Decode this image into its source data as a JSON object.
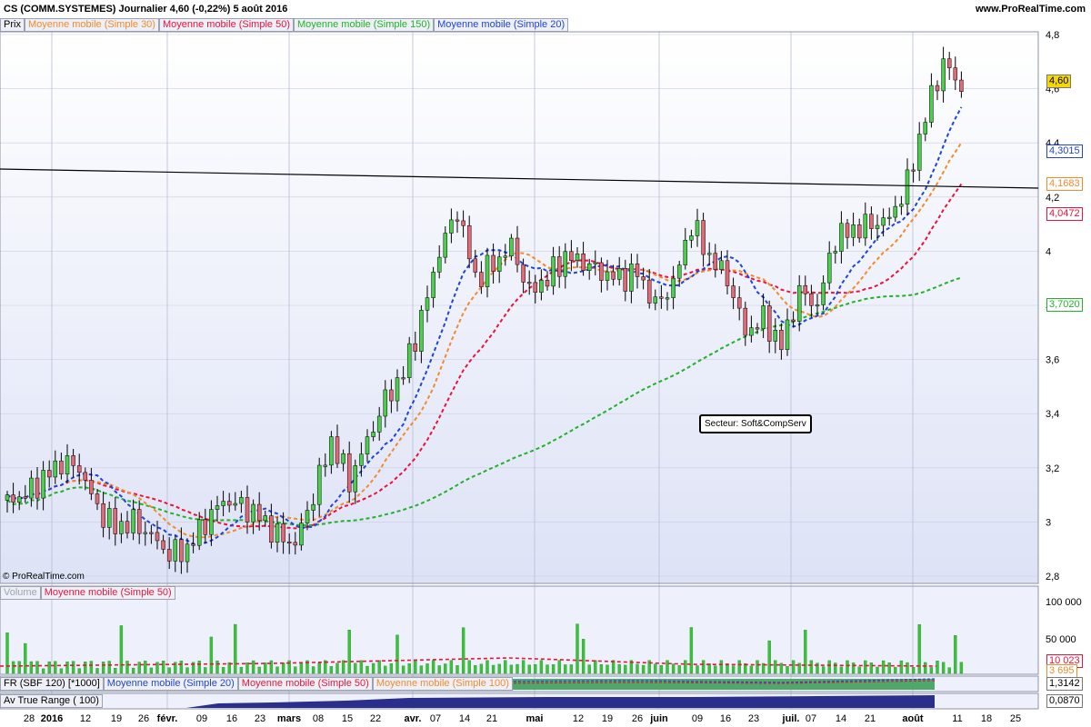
{
  "header": {
    "title": "CS (COMM.SYSTEMES)   Journalier   4,60 (-0,22%)   5 août 2016",
    "site": "www.ProRealTime.com"
  },
  "price_panel": {
    "legend": [
      "Prix",
      "Moyenne mobile (Simple 30)",
      "Moyenne mobile (Simple 50)",
      "Moyenne mobile (Simple 150)",
      "Moyenne mobile (Simple 20)"
    ],
    "y_ticks": [
      "4,8",
      "4,6",
      "4,4",
      "4,2",
      "4",
      "3,8",
      "3,6",
      "3,4",
      "3,2",
      "3",
      "2,8"
    ],
    "badges": {
      "last": "4,60",
      "ma20": "4,3015",
      "ma30": "4,1683",
      "ma50": "4,0472",
      "ma150": "3,7020"
    },
    "sector_label": "Secteur: Soft&CompServ",
    "copyright": "© ProRealTime.com",
    "colors": {
      "ma20": "#1f44d6",
      "ma30": "#f28a2e",
      "ma50": "#e8143c",
      "ma150": "#22b22a",
      "up": "#4ccf4c",
      "down": "#e06a78",
      "trend": "#000000"
    }
  },
  "volume_panel": {
    "legend": [
      "Volume",
      "Moyenne mobile (Simple 50)"
    ],
    "y_ticks": [
      "100 000",
      "50 000"
    ],
    "badges": {
      "avg": "10 023",
      "last": "3 695"
    }
  },
  "fr_panel": {
    "legend": [
      "FR (SBF 120) [*1000]",
      "Moyenne mobile (Simple 20)",
      "Moyenne mobile (Simple 50)",
      "Moyenne mobile (Simple 100)"
    ],
    "badge": "1,3142"
  },
  "atr_panel": {
    "legend": [
      "Av True Range ( 100)"
    ],
    "badge": "0,0870"
  },
  "x_axis": {
    "labels": [
      "28",
      "2016",
      "12",
      "19",
      "26",
      "févr.",
      "09",
      "16",
      "23",
      "mars",
      "08",
      "15",
      "22",
      "avr.",
      "07",
      "14",
      "21",
      "mai",
      "12",
      "19",
      "26",
      "juin",
      "09",
      "16",
      "23",
      "juil.",
      "07",
      "14",
      "21",
      "août",
      "11",
      "18",
      "25"
    ]
  },
  "chart_data": {
    "type": "candlestick",
    "title": "CS (COMM.SYSTEMES) Journalier",
    "ylim": [
      2.8,
      4.85
    ],
    "series": [
      {
        "name": "Moyenne mobile (Simple 20)",
        "last": 4.3015
      },
      {
        "name": "Moyenne mobile (Simple 30)",
        "last": 4.1683
      },
      {
        "name": "Moyenne mobile (Simple 50)",
        "last": 4.0472
      },
      {
        "name": "Moyenne mobile (Simple 150)",
        "last": 3.702
      }
    ],
    "close_path": [
      [
        0,
        3.08
      ],
      [
        6,
        3.1
      ],
      [
        12,
        3.16
      ],
      [
        18,
        3.22
      ],
      [
        24,
        3.2
      ],
      [
        30,
        3.05
      ],
      [
        36,
        2.98
      ],
      [
        42,
        3.0
      ],
      [
        48,
        2.95
      ],
      [
        54,
        2.88
      ],
      [
        60,
        2.9
      ],
      [
        66,
        3.0
      ],
      [
        72,
        3.08
      ],
      [
        78,
        3.06
      ],
      [
        84,
        3.02
      ],
      [
        90,
        2.95
      ],
      [
        96,
        2.92
      ],
      [
        102,
        3.1
      ],
      [
        108,
        3.3
      ],
      [
        114,
        3.15
      ],
      [
        120,
        3.3
      ],
      [
        126,
        3.45
      ],
      [
        132,
        3.55
      ],
      [
        138,
        3.75
      ],
      [
        144,
        4.0
      ],
      [
        150,
        4.15
      ],
      [
        156,
        3.9
      ],
      [
        162,
        3.95
      ],
      [
        168,
        4.02
      ],
      [
        174,
        3.85
      ],
      [
        180,
        3.9
      ],
      [
        186,
        3.98
      ],
      [
        192,
        3.96
      ],
      [
        198,
        3.92
      ],
      [
        204,
        3.9
      ],
      [
        210,
        3.92
      ],
      [
        216,
        3.8
      ],
      [
        222,
        3.88
      ],
      [
        228,
        4.1
      ],
      [
        234,
        3.98
      ],
      [
        240,
        3.9
      ],
      [
        246,
        3.7
      ],
      [
        252,
        3.75
      ],
      [
        258,
        3.65
      ],
      [
        264,
        3.85
      ],
      [
        270,
        3.8
      ],
      [
        276,
        4.05
      ],
      [
        282,
        4.08
      ],
      [
        288,
        4.1
      ],
      [
        294,
        4.12
      ],
      [
        300,
        4.25
      ],
      [
        306,
        4.5
      ],
      [
        312,
        4.7
      ],
      [
        318,
        4.6
      ]
    ]
  }
}
